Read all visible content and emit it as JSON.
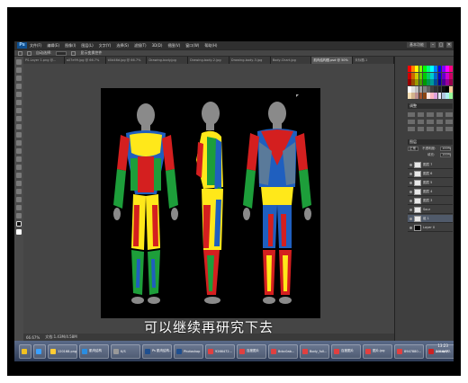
{
  "app": {
    "logo": "Ps",
    "menu": [
      "文件(F)",
      "编辑(E)",
      "图像(I)",
      "图层(L)",
      "文字(Y)",
      "选择(S)",
      "滤镜(T)",
      "3D(D)",
      "视图(V)",
      "窗口(W)",
      "帮助(H)"
    ],
    "workspace": "基本功能",
    "window_controls": [
      "–",
      "▢",
      "✕"
    ]
  },
  "options_bar": {
    "items": [
      "自动选择:",
      "显示变换控件"
    ]
  },
  "tabs": [
    {
      "label": "PS-Layer 1.png @..."
    },
    {
      "label": "a07e99.jpg @ 66.7%"
    },
    {
      "label": "ti0d46d.jpg @ 66.7%"
    },
    {
      "label": "Drawing-body.jpg"
    },
    {
      "label": "Drawing-body-2.jpg"
    },
    {
      "label": "Drawing-body-3.jpg"
    },
    {
      "label": "Body-Chart.jpg"
    },
    {
      "label": "肌肉结构图.psd @ 50%"
    },
    {
      "label": "未标题-1"
    }
  ],
  "subtitle": "可以继续再研究下去",
  "status": {
    "zoom": "66.67%",
    "doc": "文档:1.43M/4.58M"
  },
  "panels": {
    "swatch_colors": [
      "#ff0000",
      "#ff8000",
      "#ffff00",
      "#80ff00",
      "#00ff00",
      "#00ff80",
      "#00ffff",
      "#0080ff",
      "#0000ff",
      "#8000ff",
      "#ff00ff",
      "#ff0080",
      "#cc0000",
      "#cc6600",
      "#cccc00",
      "#66cc00",
      "#00cc00",
      "#00cc66",
      "#00cccc",
      "#0066cc",
      "#0000cc",
      "#6600cc",
      "#cc00cc",
      "#cc0066",
      "#990000",
      "#994c00",
      "#999900",
      "#4c9900",
      "#009900",
      "#00994c",
      "#009999",
      "#004c99",
      "#000099",
      "#4c0099",
      "#990099",
      "#99004c",
      "#ffffff",
      "#e0e0e0",
      "#c0c0c0",
      "#a0a0a0",
      "#808080",
      "#606060",
      "#404040",
      "#303030",
      "#202020",
      "#101010",
      "#000000",
      "#ffcc99",
      "#f5deb3",
      "#d2b48c",
      "#bc8f8f",
      "#a0522d",
      "#8b4513",
      "#ffe4e1",
      "#ffb6c1",
      "#dda0dd",
      "#e6e6fa",
      "#b0c4de",
      "#afeeee",
      "#98fb98"
    ],
    "adjust_head": "调整",
    "layers_head": "图层",
    "blend": "正常",
    "opacity_label": "不透明度:",
    "opacity": "100%",
    "fill_label": "填充:",
    "fill": "100%",
    "layers": [
      {
        "name": "图层 7",
        "dark": false,
        "sel": false
      },
      {
        "name": "图层 6",
        "dark": false,
        "sel": false
      },
      {
        "name": "图层 5",
        "dark": false,
        "sel": false
      },
      {
        "name": "图层 4",
        "dark": false,
        "sel": false
      },
      {
        "name": "图层 3",
        "dark": false,
        "sel": false
      },
      {
        "name": "Sour",
        "dark": false,
        "sel": false
      },
      {
        "name": "组 1",
        "dark": false,
        "sel": true
      },
      {
        "name": "Layer 0",
        "dark": true,
        "sel": false
      }
    ]
  },
  "taskbar": {
    "tasks": [
      {
        "label": "",
        "color": "#f0c020",
        "narrow": true
      },
      {
        "label": "",
        "color": "#3aa0ff",
        "narrow": true
      },
      {
        "label": "120168.png",
        "color": "#ffcc33",
        "narrow": false
      },
      {
        "label": "肌肉结构",
        "color": "#2a8de0",
        "narrow": false
      },
      {
        "label": "K/S",
        "color": "#999999",
        "narrow": false
      },
      {
        "label": "Ps 肌肉结构...",
        "color": "#1f4f8f",
        "narrow": false
      },
      {
        "label": "Photoshop",
        "color": "#1f4f8f",
        "narrow": false
      },
      {
        "label": "9266472...",
        "color": "#e04040",
        "narrow": false
      },
      {
        "label": "百度图片",
        "color": "#e04040",
        "narrow": false
      },
      {
        "label": "8cbc0ab...",
        "color": "#e04040",
        "narrow": false
      },
      {
        "label": "Body_full...",
        "color": "#e04040",
        "narrow": false
      },
      {
        "label": "百度图片",
        "color": "#e04040",
        "narrow": false
      },
      {
        "label": "图片.jpg",
        "color": "#e04040",
        "narrow": false
      },
      {
        "label": "8947880...",
        "color": "#e04040",
        "narrow": false
      },
      {
        "label": "Adobe P...",
        "color": "#cc2222",
        "narrow": false
      }
    ],
    "time": "13:23",
    "date": "2014/8/7"
  }
}
